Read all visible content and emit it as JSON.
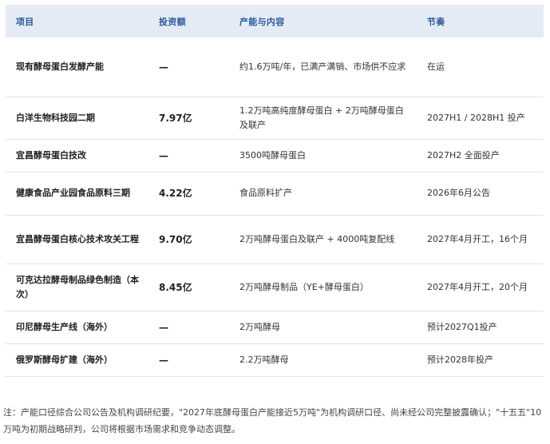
{
  "table": {
    "headers": [
      "项目",
      "投资额",
      "产能与内容",
      "节奏"
    ],
    "rows": [
      {
        "name": "现有酵母蛋白发酵产能",
        "amount": "—",
        "content": "约1.6万吨/年，已满产满销、市场供不应求",
        "rhythm": "在运"
      },
      {
        "name": "白洋生物科技园二期",
        "amount": "7.97亿",
        "content": "1.2万吨高纯度酵母蛋白 + 2万吨酵母蛋白及联产",
        "rhythm": "2027H1 / 2028H1 投产"
      },
      {
        "name": "宜昌酵母蛋白技改",
        "amount": "—",
        "content": "3500吨酵母蛋白",
        "rhythm": "2027H2 全面投产"
      },
      {
        "name": "健康食品产业园食品原料三期",
        "amount": "4.22亿",
        "content": "食品原料扩产",
        "rhythm": "2026年6月公告"
      },
      {
        "name": "宜昌酵母蛋白核心技术攻关工程",
        "amount": "9.70亿",
        "content": "2万吨酵母蛋白及联产 + 4000吨复配线",
        "rhythm": "2027年4月开工，16个月"
      },
      {
        "name": "可克达拉酵母制品绿色制造（本次）",
        "amount": "8.45亿",
        "content": "2万吨酵母制品（YE+酵母蛋白）",
        "rhythm": "2027年4月开工，20个月"
      },
      {
        "name": "印尼酵母生产线（海外）",
        "amount": "—",
        "content": "2万吨酵母",
        "rhythm": "预计2027Q1投产"
      },
      {
        "name": "俄罗斯酵母扩建（海外）",
        "amount": "—",
        "content": "2.2万吨酵母",
        "rhythm": "预计2028年投产"
      }
    ]
  },
  "note": "注：产能口径综合公司公告及机构调研纪要，\"2027年底酵母蛋白产能接近5万吨\"为机构调研口径、尚未经公司完整披露确认；\"十五五\"10万吨为初期战略研判，公司将根据市场需求和竞争动态调整。",
  "colors": {
    "header_bg": "#e5ebf5",
    "header_text": "#2b5a9a",
    "row_border": "#dde3ec"
  }
}
